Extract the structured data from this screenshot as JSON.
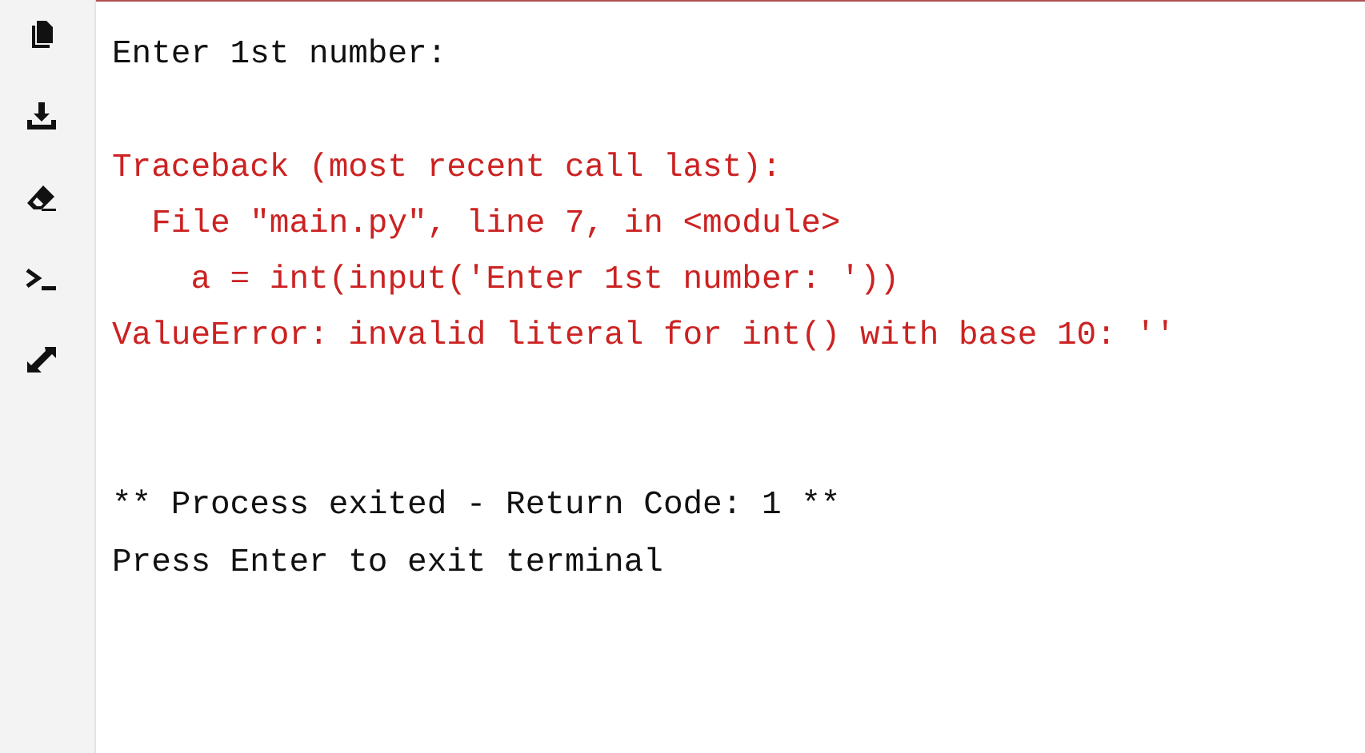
{
  "toolbar": {
    "tools": [
      {
        "kind": "copy"
      },
      {
        "kind": "download"
      },
      {
        "kind": "erase"
      },
      {
        "kind": "terminal"
      },
      {
        "kind": "expand"
      }
    ]
  },
  "terminal": {
    "lines": [
      {
        "kind": "output",
        "text": "Enter 1st number:"
      },
      {
        "kind": "blank"
      },
      {
        "kind": "error",
        "text": "Traceback (most recent call last):"
      },
      {
        "kind": "error",
        "text": "  File \"main.py\", line 7, in <module>"
      },
      {
        "kind": "error",
        "text": "    a = int(input('Enter 1st number: '))"
      },
      {
        "kind": "error",
        "text": "ValueError: invalid literal for int() with base 10: ''"
      },
      {
        "kind": "blank"
      },
      {
        "kind": "blank"
      },
      {
        "kind": "output",
        "text": "** Process exited - Return Code: 1 **"
      },
      {
        "kind": "output",
        "text": "Press Enter to exit terminal"
      }
    ]
  }
}
